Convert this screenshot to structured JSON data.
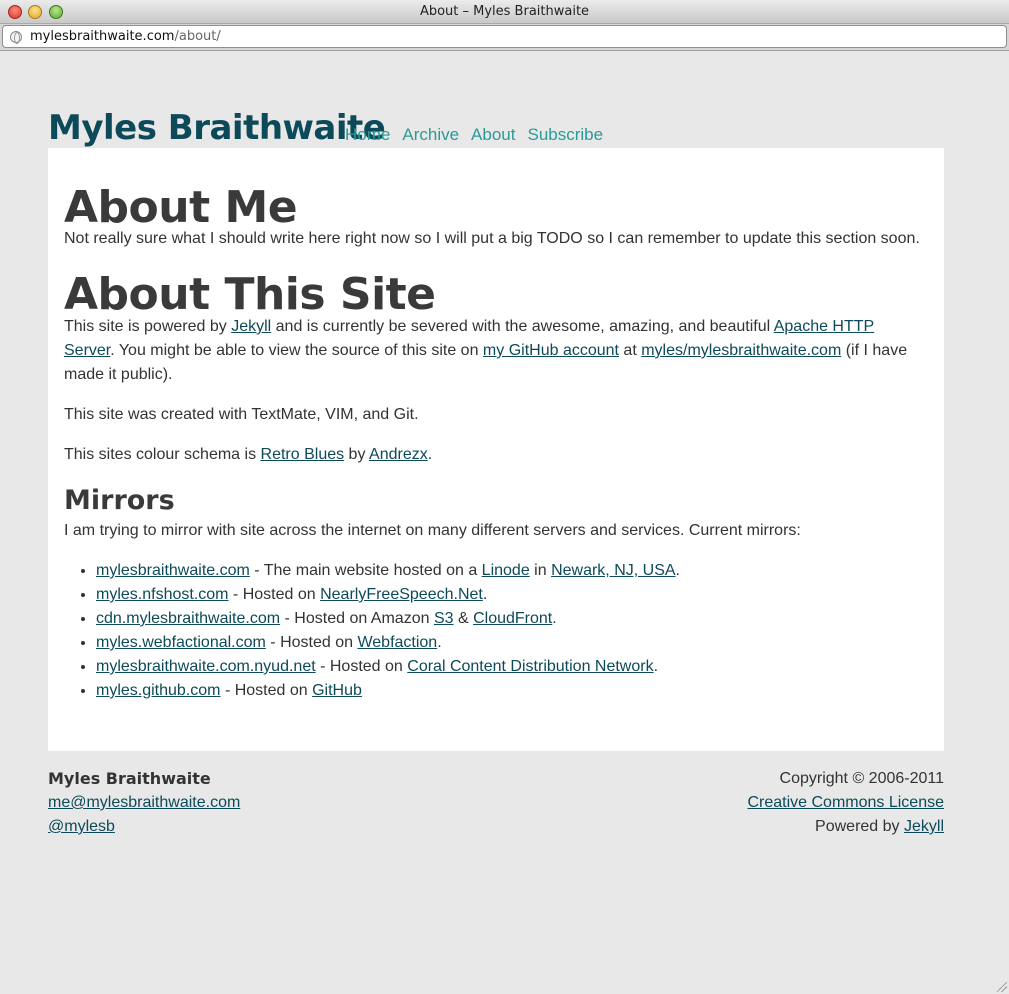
{
  "window": {
    "title": "About – Myles Braithwaite"
  },
  "address": {
    "host": "mylesbraithwaite.com",
    "path": "/about/"
  },
  "site": {
    "title": "Myles Braithwaite"
  },
  "nav": [
    "Home",
    "Archive",
    "About",
    "Subscribe"
  ],
  "about_me": {
    "heading": "About Me",
    "text": "Not really sure what I should write here right now so I will put a big TODO so I can remember to update this section soon."
  },
  "about_site": {
    "heading": "About This Site",
    "p1": {
      "t1": "This site is powered by ",
      "l1": "Jekyll",
      "t2": " and is currently be severed with the awesome, amazing, and beautiful ",
      "l2": "Apache HTTP Server",
      "t3": ". You might be able to view the source of this site on ",
      "l3": "my GitHub account",
      "t4": " at ",
      "l4": "myles/mylesbraithwaite.com",
      "t5": " (if I have made it public)."
    },
    "p2": "This site was created with TextMate, VIM, and Git.",
    "p3": {
      "t1": "This sites colour schema is ",
      "l1": "Retro Blues",
      "t2": " by ",
      "l2": "Andrezx",
      "t3": "."
    }
  },
  "mirrors": {
    "heading": "Mirrors",
    "intro": "I am trying to mirror with site across the internet on many different servers and services. Current mirrors:",
    "items": [
      {
        "site": "mylesbraithwaite.com",
        "t1": " - The main website hosted on a ",
        "l1": "Linode",
        "t2": " in ",
        "l2": "Newark, NJ, USA",
        "t3": "."
      },
      {
        "site": "myles.nfshost.com",
        "t1": " - Hosted on ",
        "l1": "NearlyFreeSpeech.Net",
        "t2": ".",
        "l2": "",
        "t3": ""
      },
      {
        "site": "cdn.mylesbraithwaite.com",
        "t1": " - Hosted on Amazon ",
        "l1": "S3",
        "t2": " & ",
        "l2": "CloudFront",
        "t3": "."
      },
      {
        "site": "myles.webfactional.com",
        "t1": " - Hosted on ",
        "l1": "Webfaction",
        "t2": ".",
        "l2": "",
        "t3": ""
      },
      {
        "site": "mylesbraithwaite.com.nyud.net",
        "t1": " - Hosted on ",
        "l1": "Coral Content Distribution Network",
        "t2": ".",
        "l2": "",
        "t3": ""
      },
      {
        "site": "myles.github.com",
        "t1": " - Hosted on ",
        "l1": "GitHub",
        "t2": "",
        "l2": "",
        "t3": ""
      }
    ]
  },
  "footer": {
    "name": "Myles Braithwaite",
    "email": "me@mylesbraithwaite.com",
    "twitter": "@mylesb",
    "copyright": "Copyright © 2006-2011",
    "license": "Creative Commons License",
    "powered_text": "Powered by ",
    "powered_link": "Jekyll"
  },
  "colors": {
    "title": "#0d4a59",
    "nav": "#2a9b97",
    "link": "#0d4a59",
    "page_bg": "#e8e8e8"
  }
}
